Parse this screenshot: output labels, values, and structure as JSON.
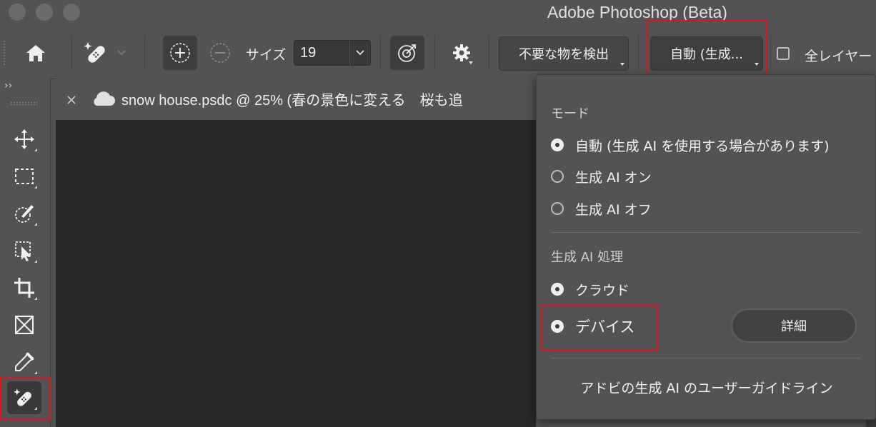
{
  "app": {
    "title": "Adobe Photoshop (Beta)"
  },
  "options_bar": {
    "size_label": "サイズ",
    "size_value": "19",
    "detect_button": "不要な物を検出",
    "mode_button": "自動 (生成...",
    "all_layers_label": "全レイヤー"
  },
  "panel_toggle": "››",
  "document": {
    "tab_title": "snow house.psdc @ 25% (春の景色に変える　桜も追"
  },
  "mode_menu": {
    "mode_heading": "モード",
    "mode_options": [
      {
        "label": "自動 (生成 AI を使用する場合があります)",
        "selected": true
      },
      {
        "label": "生成 AI オン",
        "selected": false
      },
      {
        "label": "生成 AI オフ",
        "selected": false
      }
    ],
    "processing_heading": "生成 AI 処理",
    "processing_options": [
      {
        "label": "クラウド",
        "selected": true
      },
      {
        "label": "デバイス",
        "selected": true
      }
    ],
    "detail_button": "詳細",
    "guideline_link": "アドビの生成 AI のユーザーガイドライン"
  },
  "colors": {
    "ui_gray": "#535353",
    "canvas": "#282828",
    "highlight_red": "#e0151b"
  },
  "icons": [
    "home-icon",
    "remove-tool-icon",
    "add-brush-icon",
    "subtract-brush-icon",
    "target-icon",
    "gear-icon",
    "close-icon",
    "cloud-icon",
    "move-icon",
    "marquee-icon",
    "quick-selection-icon",
    "object-selection-icon",
    "crop-icon",
    "frame-icon",
    "eyedropper-icon",
    "healing-remove-icon"
  ]
}
